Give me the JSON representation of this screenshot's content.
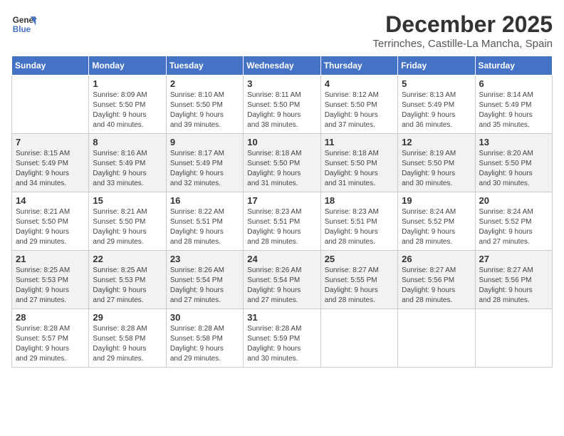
{
  "logo": {
    "line1": "General",
    "line2": "Blue"
  },
  "title": "December 2025",
  "subtitle": "Terrinches, Castille-La Mancha, Spain",
  "days_of_week": [
    "Sunday",
    "Monday",
    "Tuesday",
    "Wednesday",
    "Thursday",
    "Friday",
    "Saturday"
  ],
  "weeks": [
    [
      {
        "day": "",
        "info": ""
      },
      {
        "day": "1",
        "info": "Sunrise: 8:09 AM\nSunset: 5:50 PM\nDaylight: 9 hours\nand 40 minutes."
      },
      {
        "day": "2",
        "info": "Sunrise: 8:10 AM\nSunset: 5:50 PM\nDaylight: 9 hours\nand 39 minutes."
      },
      {
        "day": "3",
        "info": "Sunrise: 8:11 AM\nSunset: 5:50 PM\nDaylight: 9 hours\nand 38 minutes."
      },
      {
        "day": "4",
        "info": "Sunrise: 8:12 AM\nSunset: 5:50 PM\nDaylight: 9 hours\nand 37 minutes."
      },
      {
        "day": "5",
        "info": "Sunrise: 8:13 AM\nSunset: 5:49 PM\nDaylight: 9 hours\nand 36 minutes."
      },
      {
        "day": "6",
        "info": "Sunrise: 8:14 AM\nSunset: 5:49 PM\nDaylight: 9 hours\nand 35 minutes."
      }
    ],
    [
      {
        "day": "7",
        "info": "Sunrise: 8:15 AM\nSunset: 5:49 PM\nDaylight: 9 hours\nand 34 minutes."
      },
      {
        "day": "8",
        "info": "Sunrise: 8:16 AM\nSunset: 5:49 PM\nDaylight: 9 hours\nand 33 minutes."
      },
      {
        "day": "9",
        "info": "Sunrise: 8:17 AM\nSunset: 5:49 PM\nDaylight: 9 hours\nand 32 minutes."
      },
      {
        "day": "10",
        "info": "Sunrise: 8:18 AM\nSunset: 5:50 PM\nDaylight: 9 hours\nand 31 minutes."
      },
      {
        "day": "11",
        "info": "Sunrise: 8:18 AM\nSunset: 5:50 PM\nDaylight: 9 hours\nand 31 minutes."
      },
      {
        "day": "12",
        "info": "Sunrise: 8:19 AM\nSunset: 5:50 PM\nDaylight: 9 hours\nand 30 minutes."
      },
      {
        "day": "13",
        "info": "Sunrise: 8:20 AM\nSunset: 5:50 PM\nDaylight: 9 hours\nand 30 minutes."
      }
    ],
    [
      {
        "day": "14",
        "info": "Sunrise: 8:21 AM\nSunset: 5:50 PM\nDaylight: 9 hours\nand 29 minutes."
      },
      {
        "day": "15",
        "info": "Sunrise: 8:21 AM\nSunset: 5:50 PM\nDaylight: 9 hours\nand 29 minutes."
      },
      {
        "day": "16",
        "info": "Sunrise: 8:22 AM\nSunset: 5:51 PM\nDaylight: 9 hours\nand 28 minutes."
      },
      {
        "day": "17",
        "info": "Sunrise: 8:23 AM\nSunset: 5:51 PM\nDaylight: 9 hours\nand 28 minutes."
      },
      {
        "day": "18",
        "info": "Sunrise: 8:23 AM\nSunset: 5:51 PM\nDaylight: 9 hours\nand 28 minutes."
      },
      {
        "day": "19",
        "info": "Sunrise: 8:24 AM\nSunset: 5:52 PM\nDaylight: 9 hours\nand 28 minutes."
      },
      {
        "day": "20",
        "info": "Sunrise: 8:24 AM\nSunset: 5:52 PM\nDaylight: 9 hours\nand 27 minutes."
      }
    ],
    [
      {
        "day": "21",
        "info": "Sunrise: 8:25 AM\nSunset: 5:53 PM\nDaylight: 9 hours\nand 27 minutes."
      },
      {
        "day": "22",
        "info": "Sunrise: 8:25 AM\nSunset: 5:53 PM\nDaylight: 9 hours\nand 27 minutes."
      },
      {
        "day": "23",
        "info": "Sunrise: 8:26 AM\nSunset: 5:54 PM\nDaylight: 9 hours\nand 27 minutes."
      },
      {
        "day": "24",
        "info": "Sunrise: 8:26 AM\nSunset: 5:54 PM\nDaylight: 9 hours\nand 27 minutes."
      },
      {
        "day": "25",
        "info": "Sunrise: 8:27 AM\nSunset: 5:55 PM\nDaylight: 9 hours\nand 28 minutes."
      },
      {
        "day": "26",
        "info": "Sunrise: 8:27 AM\nSunset: 5:56 PM\nDaylight: 9 hours\nand 28 minutes."
      },
      {
        "day": "27",
        "info": "Sunrise: 8:27 AM\nSunset: 5:56 PM\nDaylight: 9 hours\nand 28 minutes."
      }
    ],
    [
      {
        "day": "28",
        "info": "Sunrise: 8:28 AM\nSunset: 5:57 PM\nDaylight: 9 hours\nand 29 minutes."
      },
      {
        "day": "29",
        "info": "Sunrise: 8:28 AM\nSunset: 5:58 PM\nDaylight: 9 hours\nand 29 minutes."
      },
      {
        "day": "30",
        "info": "Sunrise: 8:28 AM\nSunset: 5:58 PM\nDaylight: 9 hours\nand 29 minutes."
      },
      {
        "day": "31",
        "info": "Sunrise: 8:28 AM\nSunset: 5:59 PM\nDaylight: 9 hours\nand 30 minutes."
      },
      {
        "day": "",
        "info": ""
      },
      {
        "day": "",
        "info": ""
      },
      {
        "day": "",
        "info": ""
      }
    ]
  ]
}
